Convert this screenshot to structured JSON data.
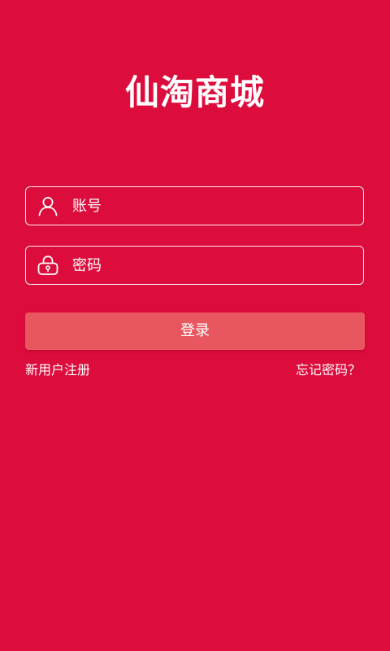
{
  "app": {
    "title": "仙淘商城"
  },
  "login_form": {
    "account": {
      "placeholder": "账号",
      "value": "",
      "icon": "user-icon"
    },
    "password": {
      "placeholder": "密码",
      "value": "",
      "icon": "lock-icon"
    },
    "submit_label": "登录"
  },
  "links": {
    "register": "新用户注册",
    "forgot_password": "忘记密码？"
  },
  "colors": {
    "background": "#dc0c3c",
    "button": "#e8575f",
    "text": "#ffffff",
    "field_border": "#ffffff"
  }
}
